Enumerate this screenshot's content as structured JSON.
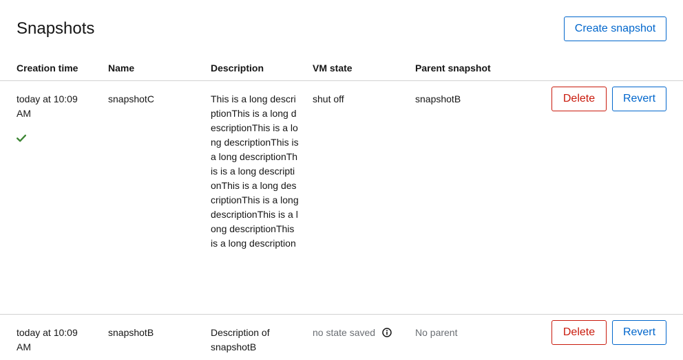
{
  "page": {
    "title": "Snapshots",
    "create_button_label": "Create snapshot"
  },
  "table": {
    "headers": {
      "creation_time": "Creation time",
      "name": "Name",
      "description": "Description",
      "vm_state": "VM state",
      "parent_snapshot": "Parent snapshot"
    },
    "rows": [
      {
        "creation_time": "today at 10:09 AM",
        "is_current": true,
        "current_icon": "check-icon",
        "name": "snapshotC",
        "description": "This is a long descriptionThis is a long descriptionThis is a long descriptionThis is a long descriptionThis is a long descriptionThis is a long descriptionThis is a long descriptionThis is a long descriptionThis is a long description",
        "vm_state": "shut off",
        "parent_snapshot": "snapshotB",
        "delete_label": "Delete",
        "revert_label": "Revert"
      },
      {
        "creation_time": "today at 10:09 AM",
        "is_current": false,
        "name": "snapshotB",
        "description": "Description of snapshotB",
        "vm_state": "no state saved",
        "vm_state_icon": "info-icon",
        "parent_snapshot": "No parent",
        "delete_label": "Delete",
        "revert_label": "Revert"
      }
    ]
  },
  "colors": {
    "primary": "#0066cc",
    "danger": "#c9190b",
    "success": "#3e8635",
    "muted_text": "#6a6e73",
    "divider": "#d2d2d2"
  }
}
